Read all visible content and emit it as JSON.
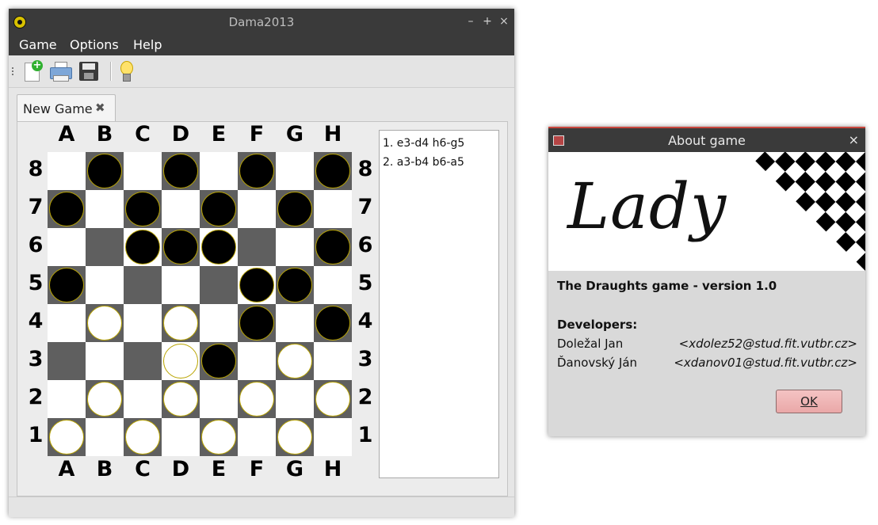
{
  "main_window": {
    "title": "Dama2013",
    "buttons": {
      "minimize": "–",
      "maximize": "+",
      "close": "×"
    },
    "menu": [
      "Game",
      "Options",
      "Help"
    ],
    "toolbar": {
      "items": [
        {
          "icon": "new-game-icon"
        },
        {
          "icon": "print-icon"
        },
        {
          "icon": "save-icon"
        },
        {
          "icon": "hint-bulb-icon"
        }
      ]
    },
    "tab": {
      "label": "New Game",
      "close": "✖"
    },
    "board": {
      "files": [
        "A",
        "B",
        "C",
        "D",
        "E",
        "F",
        "G",
        "H"
      ],
      "ranks": [
        "8",
        "7",
        "6",
        "5",
        "4",
        "3",
        "2",
        "1"
      ],
      "colors": {
        "light": "#ffffff",
        "dark": "#5f5f5f",
        "piece_outline": "#b9a400"
      },
      "layout": [
        "dbdbdbdb",
        "bdbdbdbd",
        "ddbbbddb",
        "bddddbbd",
        "dwdwdbdb",
        "dddwbdwd",
        "dwdwdwdw",
        "wdwdwdwd"
      ],
      "legend": "b = black piece on dark square, w = white piece on dark square, d = dark square, shown as layout string per rank 8..1"
    },
    "moves": [
      "1. e3-d4 h6-g5",
      "2. a3-b4 b6-a5"
    ]
  },
  "about_dialog": {
    "title": "About game",
    "close": "×",
    "logo_text": "Lady",
    "version_line": "The Draughts game - version 1.0",
    "developers_heading": "Developers:",
    "developers": [
      {
        "name": "Doležal Jan",
        "email": "<xdolez52@stud.fit.vutbr.cz>"
      },
      {
        "name": "Ďanovský Ján",
        "email": "<xdanov01@stud.fit.vutbr.cz>"
      }
    ],
    "ok_label": "OK"
  }
}
